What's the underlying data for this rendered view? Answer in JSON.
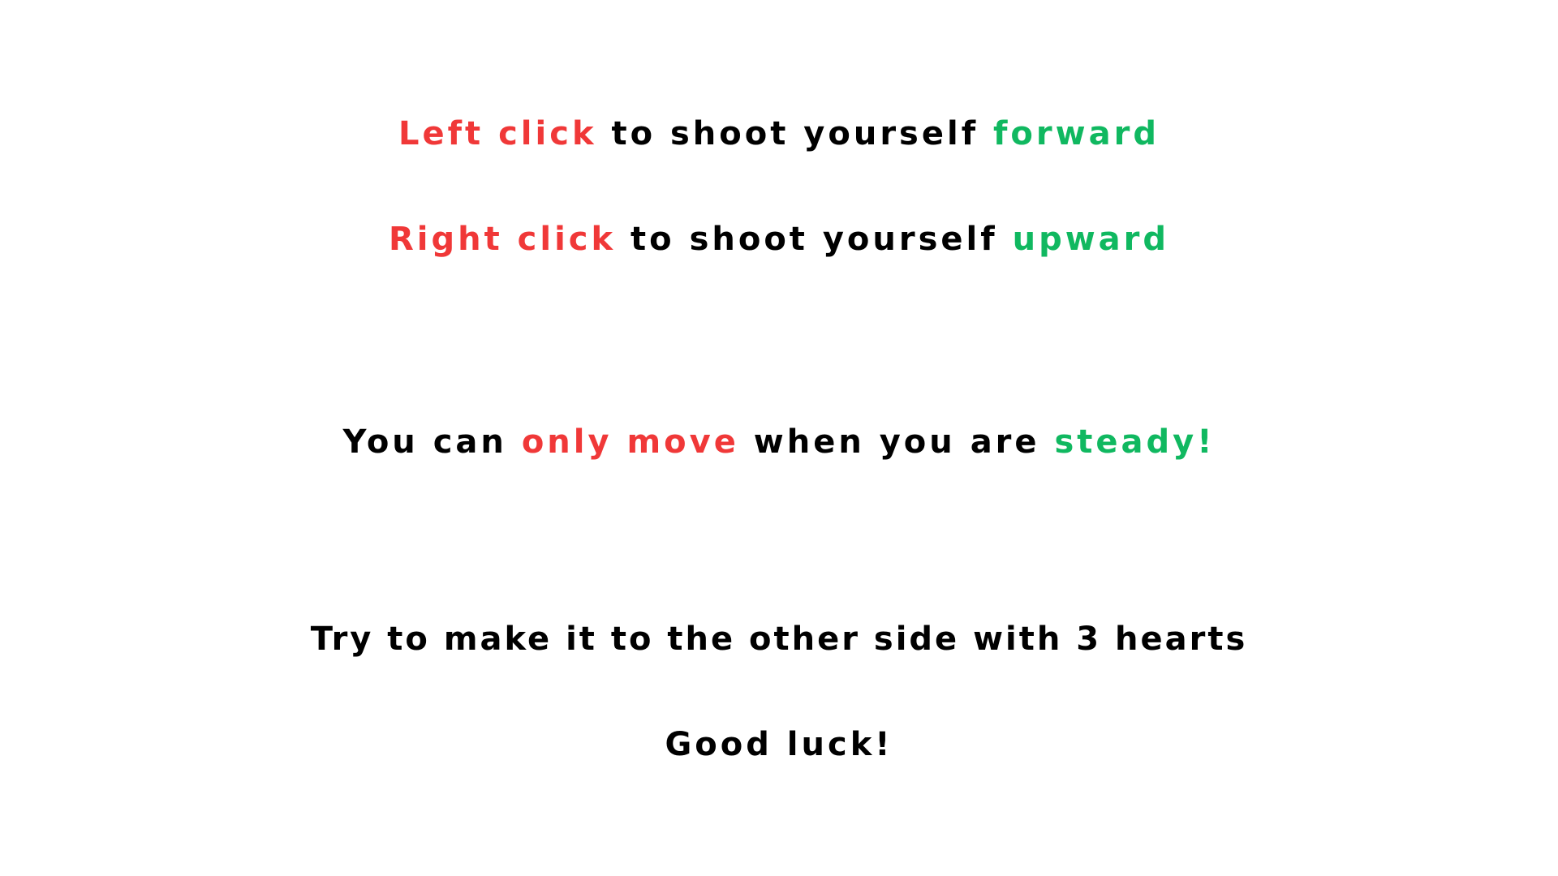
{
  "colors": {
    "highlight_red": "#f03838",
    "highlight_green": "#10b860",
    "text": "#000000",
    "background": "#ffffff"
  },
  "instructions": {
    "line1": {
      "action": "Left click",
      "middle": " to shoot yourself ",
      "direction": "forward"
    },
    "line2": {
      "action": "Right click",
      "middle": " to shoot yourself ",
      "direction": "upward"
    },
    "line3": {
      "start": "You can ",
      "restriction": "only move",
      "middle": " when you are ",
      "condition": "steady!"
    },
    "line4": {
      "text": "Try to make it to the other side with 3 hearts"
    },
    "line5": {
      "text": "Good luck!"
    }
  }
}
